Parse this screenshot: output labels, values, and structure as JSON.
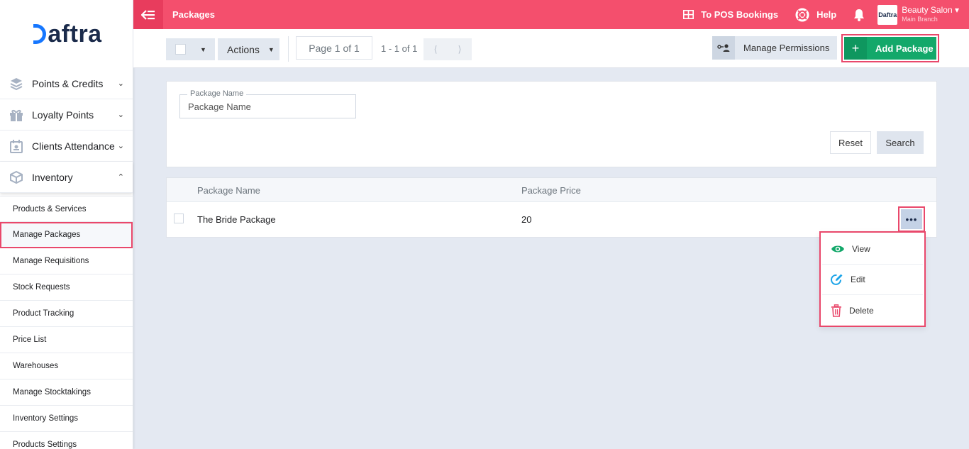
{
  "brand": {
    "logo_text": "aftra"
  },
  "sidebar": {
    "items": [
      {
        "label": "Points & Credits",
        "icon": "layers-icon"
      },
      {
        "label": "Loyalty Points",
        "icon": "gift-icon"
      },
      {
        "label": "Clients Attendance",
        "icon": "calendar-icon"
      },
      {
        "label": "Inventory",
        "icon": "box-icon"
      }
    ],
    "inventory_sub": [
      "Products & Services",
      "Manage Packages",
      "Manage Requisitions",
      "Stock Requests",
      "Product Tracking",
      "Price List",
      "Warehouses",
      "Manage Stocktakings",
      "Inventory Settings",
      "Products Settings"
    ]
  },
  "topbar": {
    "title": "Packages",
    "pos_link": "To POS Bookings",
    "help": "Help",
    "account_name": "Beauty Salon",
    "account_branch": "Main Branch",
    "account_logo": "Daftra"
  },
  "toolbar": {
    "actions_label": "Actions",
    "page_label": "Page 1 of 1",
    "range_label": "1 - 1 of 1",
    "manage_permissions": "Manage Permissions",
    "add_package": "Add Package"
  },
  "filter": {
    "field_label": "Package Name",
    "field_placeholder": "Package Name",
    "reset": "Reset",
    "search": "Search"
  },
  "table": {
    "columns": [
      "Package Name",
      "Package Price"
    ],
    "rows": [
      {
        "name": "The Bride Package",
        "price": "20"
      }
    ]
  },
  "row_menu": {
    "view": "View",
    "edit": "Edit",
    "delete": "Delete"
  },
  "colors": {
    "topbar": "#f44f6d",
    "add_button": "#13a86a",
    "highlight": "#e9486b"
  }
}
